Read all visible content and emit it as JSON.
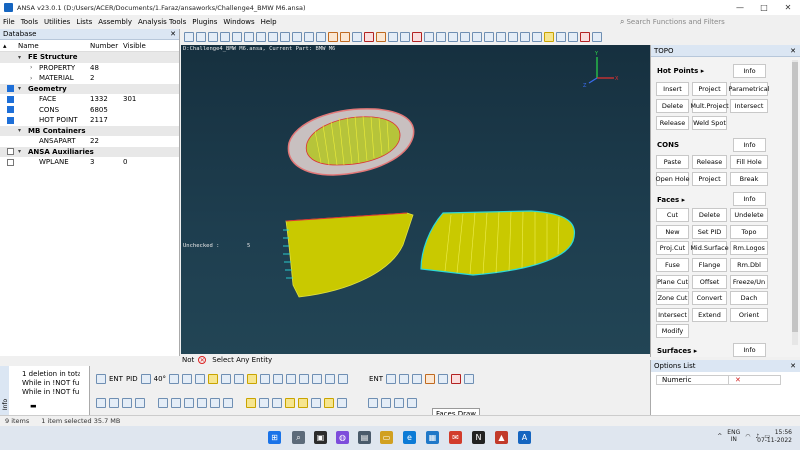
{
  "window": {
    "title": "ANSA v23.0.1 (D:/Users/ACER/Documents/1.Faraz/ansaworks/Challenge4_BMW M6.ansa)",
    "minimize": "—",
    "maximize": "□",
    "close": "✕"
  },
  "menu": {
    "items": [
      "File",
      "Tools",
      "Utilities",
      "Lists",
      "Assembly",
      "Analysis Tools",
      "Plugins",
      "Windows",
      "Help"
    ],
    "search_placeholder": "Search Functions and Filters"
  },
  "database": {
    "title": "Database",
    "columns": {
      "name": "Name",
      "number": "Number",
      "visible": "Visible"
    },
    "rows": [
      {
        "label": "FE Structure",
        "category": true,
        "checked": null
      },
      {
        "label": "PROPERTY",
        "number": "48",
        "visible": ""
      },
      {
        "label": "MATERIAL",
        "number": "2",
        "visible": ""
      },
      {
        "label": "Geometry",
        "category": true,
        "checked": true
      },
      {
        "label": "FACE",
        "number": "1332",
        "visible": "301"
      },
      {
        "label": "CONS",
        "number": "6805",
        "visible": ""
      },
      {
        "label": "HOT POINT",
        "number": "2117",
        "visible": ""
      },
      {
        "label": "MB Containers",
        "category": true,
        "checked": null
      },
      {
        "label": "ANSAPART",
        "number": "22",
        "visible": ""
      },
      {
        "label": "ANSA Auxiliaries",
        "category": true,
        "checked": false
      },
      {
        "label": "WPLANE",
        "number": "3",
        "visible": "0"
      }
    ]
  },
  "viewport": {
    "header": "D:Challenge4_BMW M6.ansa,  Current Part: BMW M6",
    "unchecked_label": "Unchecked :",
    "unchecked_value": "5",
    "axis_y": "Y",
    "axis_x": "X",
    "axis_z": "Z"
  },
  "topo": {
    "title": "TOPO",
    "sections": [
      {
        "title": "Hot Points ▸",
        "info": "Info",
        "buttons": [
          "Insert",
          "Project",
          "Parametrical",
          "Delete",
          "Mult.Project",
          "Intersect",
          "Release",
          "Weld Spot"
        ]
      },
      {
        "title": "CONS",
        "info": "Info",
        "buttons": [
          "Paste",
          "Release",
          "Fill Hole",
          "Open Hole",
          "Project",
          "Break"
        ]
      },
      {
        "title": "Faces ▸",
        "info": "Info",
        "buttons": [
          "Cut",
          "Delete",
          "Undelete",
          "New",
          "Set PID",
          "Topo",
          "Proj.Cut",
          "Mid.Surface",
          "Rm.Logos",
          "Fuse",
          "Flange",
          "Rm.Dbl",
          "Plane Cut",
          "Offset",
          "Freeze/Un",
          "Zone Cut",
          "Convert",
          "Dach",
          "Intersect",
          "Extend",
          "Orient",
          "Modify"
        ]
      },
      {
        "title": "Surfaces ▸",
        "info": "Info",
        "buttons": []
      }
    ]
  },
  "options": {
    "title": "Options List",
    "key": "Numeric",
    "value": "✕"
  },
  "cmdline": {
    "not_label": "Not",
    "prompt": "Select Any Entity"
  },
  "info_panel": {
    "side_label": "Info",
    "lines": [
      "1 deletion in total",
      "While in !NOT fun",
      "While in !NOT func",
      "▬"
    ]
  },
  "bottom_toolbar": {
    "ent_label": "ENT",
    "pid_label": "PID",
    "angle": "40°",
    "ent_label2": "ENT",
    "tooltip": "Faces Draw"
  },
  "statusbar": {
    "items": "9 items",
    "selected": "1 item selected  35.7 MB"
  },
  "taskbar": {
    "lang_top": "ENG",
    "lang_bottom": "IN",
    "time": "15:56",
    "date": "07-11-2022"
  }
}
